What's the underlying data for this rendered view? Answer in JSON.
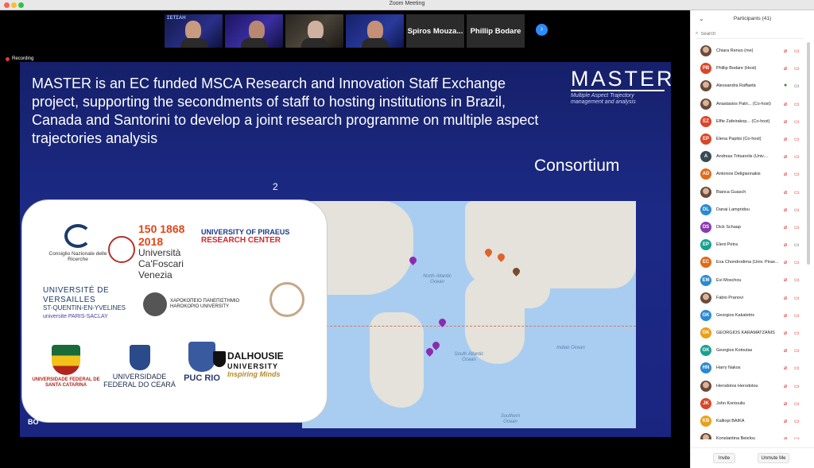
{
  "window": {
    "title": "Zoom Meeting"
  },
  "gallery": {
    "name_tiles": [
      "Spiros Mouza...",
      "Phillip Bodare"
    ],
    "thumb_logo": "ΣΕΤΣΑΗ"
  },
  "recording": {
    "label": "Recording"
  },
  "slide": {
    "body": "MASTER is an EC funded MSCA Research and Innovation Staff Exchange project, supporting the secondments of staff to hosting institutions in Brazil, Canada and Santorini to develop a joint research programme on multiple aspect trajectories analysis",
    "logo_word": "MASTER",
    "logo_sub": "Multiple Aspect Trajectory management and analysis",
    "heading": "Consortium",
    "page_number": "2",
    "footer_text": "BO",
    "map_labels": {
      "north_atlantic": "North Atlantic Ocean",
      "south_atlantic": "South Atlantic Ocean",
      "indian": "Indian Ocean",
      "southern": "Southern Ocean"
    },
    "logos": {
      "cnr": "Consiglio Nazionale delle Ricerche",
      "cafoscari_num": "150 1868 2018",
      "cafoscari": "Università Ca'Foscari Venezia",
      "piraeus_a": "UNIVERSITY OF PIRAEUS",
      "piraeus_b": "RESEARCH CENTER",
      "uvsq_a": "UNIVERSITÉ DE VERSAILLES",
      "uvsq_b": "ST-QUENTIN-EN-YVELINES",
      "uvsq_c": "universite PARIS-SACLAY",
      "harokopio": "ΧΑΡΟΚΟΠΕΙΟ ΠΑΝΕΠΙΣΤΗΜΙΟ HAROKOPIO UNIVERSITY",
      "ufsc": "UNIVERSIDADE FEDERAL DE SANTA CATARINA",
      "ufc": "UNIVERSIDADE FEDERAL DO CEARÁ",
      "puc": "PUC RIO",
      "dal_a": "DALHOUSIE",
      "dal_b": "UNIVERSITY",
      "dal_c": "Inspiring Minds"
    }
  },
  "participants": {
    "title": "Participants (41)",
    "search_placeholder": "Search",
    "list": [
      {
        "initials": "",
        "color": "",
        "name": "Chiara Renso (me)",
        "mic": "off",
        "cam": "off"
      },
      {
        "initials": "PB",
        "color": "#d9462a",
        "name": "Phillip Bodare (Host)",
        "mic": "off",
        "cam": "off"
      },
      {
        "initials": "",
        "color": "",
        "name": "Alessandra Raffaetà",
        "mic": "on",
        "cam": "on"
      },
      {
        "initials": "",
        "color": "",
        "name": "Anastasios Patri... (Co-host)",
        "mic": "off",
        "cam": "off"
      },
      {
        "initials": "EZ",
        "color": "#d9462a",
        "name": "Effie Zafeirakop... (Co-host)",
        "mic": "off",
        "cam": "off"
      },
      {
        "initials": "EP",
        "color": "#d9462a",
        "name": "Elena Papitsi (Co-host)",
        "mic": "off",
        "cam": "off"
      },
      {
        "initials": "A",
        "color": "#3a4a55",
        "name": "Andreas Tritsarolis (Univ....",
        "mic": "off",
        "cam": "off"
      },
      {
        "initials": "AD",
        "color": "#e06a1a",
        "name": "Antonios Deligiannakis",
        "mic": "off",
        "cam": "off"
      },
      {
        "initials": "",
        "color": "",
        "name": "Bianca Guasch",
        "mic": "off",
        "cam": "off"
      },
      {
        "initials": "DL",
        "color": "#2a8ad0",
        "name": "Danai Lampridou",
        "mic": "off",
        "cam": "off"
      },
      {
        "initials": "DS",
        "color": "#8a3ab0",
        "name": "Dick Schaap",
        "mic": "off",
        "cam": "off"
      },
      {
        "initials": "EP",
        "color": "#1aa090",
        "name": "Eleni Petra",
        "mic": "off",
        "cam": "on"
      },
      {
        "initials": "EC",
        "color": "#e06a1a",
        "name": "Eva Chondrodima (Univ. Pirae...",
        "mic": "off",
        "cam": "off"
      },
      {
        "initials": "EM",
        "color": "#2a8ad0",
        "name": "Evi Moschou",
        "mic": "off",
        "cam": "off"
      },
      {
        "initials": "",
        "color": "",
        "name": "Fabio Pranovi",
        "mic": "off",
        "cam": "off"
      },
      {
        "initials": "GK",
        "color": "#2a8ad0",
        "name": "Georgios Kakaletris",
        "mic": "off",
        "cam": "off"
      },
      {
        "initials": "GK",
        "color": "#e8a01a",
        "name": "GEORGIOS KARAMATZANIS",
        "mic": "off",
        "cam": "off"
      },
      {
        "initials": "GK",
        "color": "#1aa090",
        "name": "Georgios Kotoulas",
        "mic": "off",
        "cam": "off"
      },
      {
        "initials": "HN",
        "color": "#2a8ad0",
        "name": "Harry Nakos",
        "mic": "off",
        "cam": "off"
      },
      {
        "initials": "",
        "color": "",
        "name": "Herodotos Herodotou",
        "mic": "off",
        "cam": "off"
      },
      {
        "initials": "JK",
        "color": "#d9462a",
        "name": "John Kontoulis",
        "mic": "off",
        "cam": "off"
      },
      {
        "initials": "KB",
        "color": "#e8a01a",
        "name": "Kalliopi BAIKA",
        "mic": "off",
        "cam": "off"
      },
      {
        "initials": "",
        "color": "#2a8ad0",
        "name": "Konstantina Bejelou",
        "mic": "off",
        "cam": "off"
      }
    ],
    "invite_label": "Invite",
    "unmute_label": "Unmute Me"
  }
}
